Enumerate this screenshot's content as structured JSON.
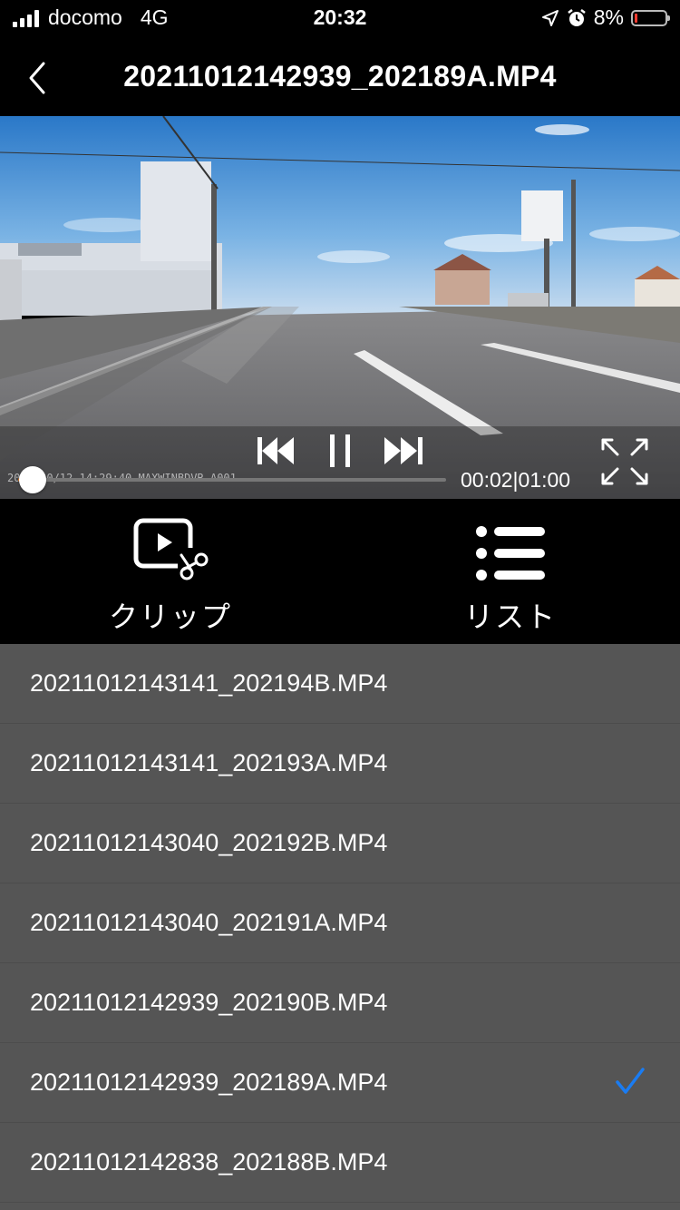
{
  "status_bar": {
    "carrier": "docomo",
    "network": "4G",
    "time": "20:32",
    "battery": "8%",
    "battery_color": "#ff3b30"
  },
  "nav": {
    "title": "20211012142939_202189A.MP4",
    "back_icon": "chevron-left-icon"
  },
  "player": {
    "current_time": "00:02",
    "total_time": "01:00",
    "time_display": "00:02|01:00",
    "progress_fraction": 0.033,
    "watermark": "2021/10/12 14:29:40 MAXWINBDVR-A001",
    "accent": "#f07d1d"
  },
  "actions": {
    "clip": {
      "label": "クリップ",
      "icon": "clip-scissors-icon"
    },
    "list": {
      "label": "リスト",
      "icon": "list-icon"
    }
  },
  "files": [
    {
      "name": "20211012143141_202194B.MP4",
      "selected": false
    },
    {
      "name": "20211012143141_202193A.MP4",
      "selected": false
    },
    {
      "name": "20211012143040_202192B.MP4",
      "selected": false
    },
    {
      "name": "20211012143040_202191A.MP4",
      "selected": false
    },
    {
      "name": "20211012142939_202190B.MP4",
      "selected": false
    },
    {
      "name": "20211012142939_202189A.MP4",
      "selected": true
    },
    {
      "name": "20211012142838_202188B.MP4",
      "selected": false
    }
  ],
  "check_color": "#1a7cf2"
}
